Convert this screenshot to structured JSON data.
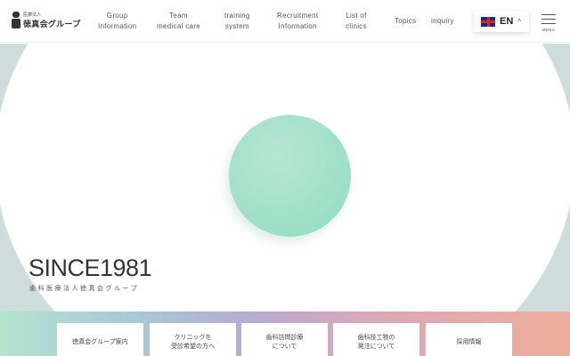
{
  "header": {
    "logo": {
      "small": "医療法人",
      "large": "徳真会グループ"
    },
    "nav": [
      {
        "line1": "Group",
        "line2": "Information"
      },
      {
        "line1": "Team",
        "line2": "medical care"
      },
      {
        "line1": "training",
        "line2": "system"
      },
      {
        "line1": "Recruitment",
        "line2": "Information"
      },
      {
        "line1": "List of",
        "line2": "clinics"
      },
      {
        "line1": "Topics",
        "line2": ""
      },
      {
        "line1": "inquiry",
        "line2": ""
      }
    ],
    "language": {
      "code": "EN",
      "caret": "^"
    },
    "menu_label": "MENU"
  },
  "hero": {
    "title": "SINCE1981",
    "subtitle": "歯科医療法人徳真会グループ"
  },
  "cards": [
    {
      "line1": "徳真会グループ案内",
      "line2": ""
    },
    {
      "line1": "クリニックを",
      "line2": "受診希望の方へ"
    },
    {
      "line1": "歯科訪問診療",
      "line2": "について"
    },
    {
      "line1": "歯科技工物の",
      "line2": "発注について"
    },
    {
      "line1": "採用情報",
      "line2": ""
    }
  ]
}
